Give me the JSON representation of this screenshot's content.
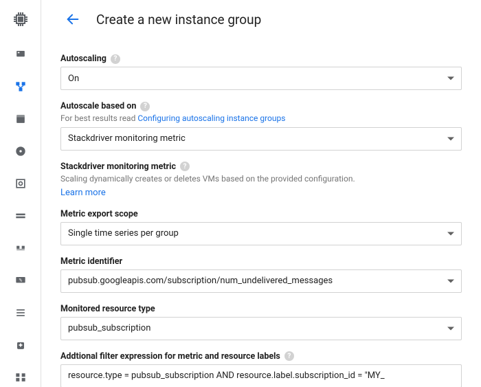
{
  "header": {
    "title": "Create a new instance group"
  },
  "form": {
    "autoscaling": {
      "label": "Autoscaling",
      "value": "On"
    },
    "autoscale_based_on": {
      "label": "Autoscale based on",
      "helper_prefix": "For best results read ",
      "helper_link": "Configuring autoscaling instance groups",
      "value": "Stackdriver monitoring metric"
    },
    "stackdriver_metric": {
      "label": "Stackdriver monitoring metric",
      "helper": "Scaling dynamically creates or deletes VMs based on the provided configuration.",
      "learn_more": "Learn more"
    },
    "metric_export_scope": {
      "label": "Metric export scope",
      "value": "Single time series per group"
    },
    "metric_identifier": {
      "label": "Metric identifier",
      "value": "pubsub.googleapis.com/subscription/num_undelivered_messages"
    },
    "monitored_resource_type": {
      "label": "Monitored resource type",
      "value": "pubsub_subscription"
    },
    "additional_filter": {
      "label": "Addtional filter expression for metric and resource labels",
      "value": "resource.type = pubsub_subscription AND resource.label.subscription_id = \"MY_"
    }
  },
  "sidebar": {
    "product_icon": "compute-engine",
    "items": [
      {
        "name": "vm-instances-icon"
      },
      {
        "name": "instance-groups-icon"
      },
      {
        "name": "instance-templates-icon"
      },
      {
        "name": "disks-icon"
      },
      {
        "name": "snapshots-icon"
      },
      {
        "name": "images-icon"
      },
      {
        "name": "tpus-icon"
      },
      {
        "name": "committed-use-icon"
      },
      {
        "name": "metadata-icon"
      },
      {
        "name": "health-checks-icon"
      },
      {
        "name": "zones-icon"
      }
    ],
    "active_index": 1
  },
  "colors": {
    "accent": "#1a73e8",
    "border": "#d2d2d2",
    "text_secondary": "#757575"
  }
}
